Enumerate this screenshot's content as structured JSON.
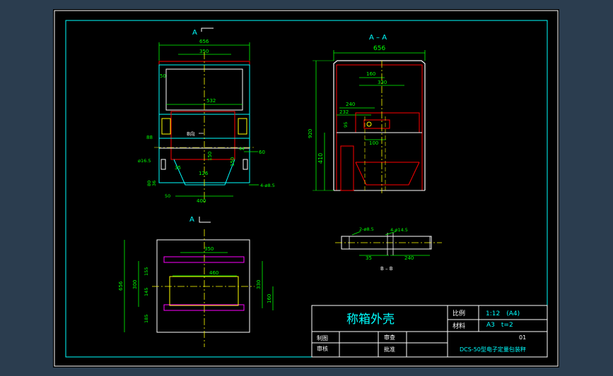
{
  "views": {
    "front_label": "A",
    "section_label": "A – A",
    "plan_label": "A",
    "bb_label": "B – B",
    "b_arrow_label": "B向"
  },
  "dimensions": {
    "front": {
      "overall_width": "656",
      "inner_width": "350",
      "top_side": "50",
      "mid_width": "532",
      "side_88": "88",
      "hole_d16": "ø16.5",
      "d60": "60",
      "d150a": "150",
      "d150b": "150",
      "d35": "35",
      "d126": "126",
      "d44": "44",
      "d80": "80",
      "d36": "36",
      "d50": "50",
      "bottom": "400",
      "holes": "4-ø8.5"
    },
    "section": {
      "overall_width": "656",
      "d160": "160",
      "d330": "330",
      "d240": "240",
      "d232": "232",
      "d95": "95",
      "d100": "100",
      "height": "920",
      "d410": "410"
    },
    "plan": {
      "depth": "656",
      "d350": "350",
      "d460": "460",
      "d300": "300",
      "d155": "155",
      "d145": "145",
      "d185": "185",
      "d330": "330",
      "d160": "160"
    },
    "bb": {
      "holes_a": "2-ø8.5",
      "holes_b": "4-ø14.5",
      "d35": "35",
      "d240": "240"
    }
  },
  "title_block": {
    "title": "称箱外壳",
    "scale_label": "比例",
    "scale_value": "1:12　(A4)",
    "material_label": "材料",
    "material_value": "A3　t=2",
    "drawn_label": "制图",
    "review_label": "审查",
    "check_label": "审核",
    "approve_label": "批准",
    "drawing_no": "01",
    "project": "DCS-50型电子定量包装秤"
  },
  "colors": {
    "background": "#2b3d4f",
    "sheet": "#000000",
    "outline": "#00ffff",
    "dims": "#00ff00",
    "hidden": "#ff0000",
    "center": "#ffff00",
    "parts": "#ffffff",
    "accent": "#ff00ff"
  }
}
